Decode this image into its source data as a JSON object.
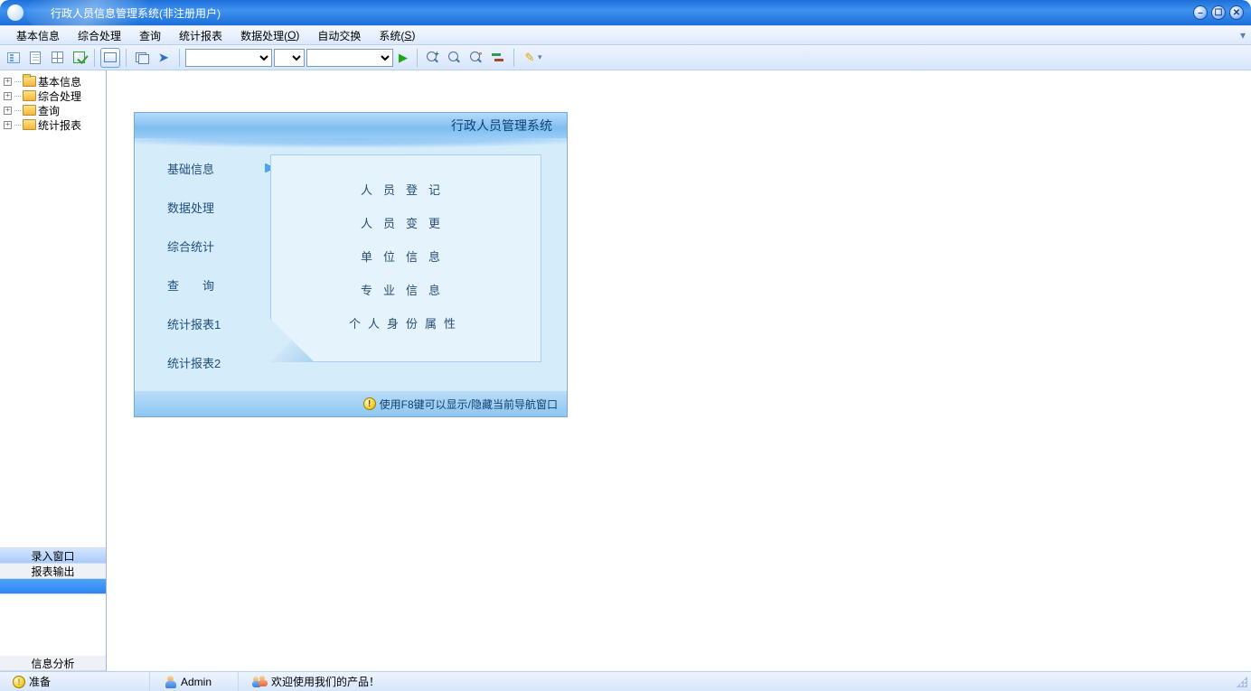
{
  "window": {
    "title": "行政人员信息管理系统(非注册用户)"
  },
  "menu": {
    "items": [
      {
        "label": "基本信息"
      },
      {
        "label": "综合处理"
      },
      {
        "label": "查询"
      },
      {
        "label": "统计报表"
      },
      {
        "label_pre": "数据处理(",
        "hot": "O",
        "label_post": ")"
      },
      {
        "label": "自动交换"
      },
      {
        "label_pre": "系统(",
        "hot": "S",
        "label_post": ")"
      }
    ]
  },
  "toolbar": {
    "combo1": "",
    "combo2": "",
    "combo3": ""
  },
  "tree": {
    "items": [
      {
        "label": "基本信息"
      },
      {
        "label": "综合处理"
      },
      {
        "label": "查询"
      },
      {
        "label": "统计报表"
      }
    ]
  },
  "sidebar_tabs": {
    "t1": "录入窗口",
    "t2": "报表输出",
    "t3": "信息分析"
  },
  "nav": {
    "header": "行政人员管理系统",
    "menu": [
      {
        "label": "基础信息"
      },
      {
        "label": "数据处理"
      },
      {
        "label": "综合统计"
      },
      {
        "label": "查　　询"
      },
      {
        "label": "统计报表1"
      },
      {
        "label": "统计报表2"
      }
    ],
    "options": [
      "人员登记",
      "人员变更",
      "单位信息",
      "专业信息",
      "个人身份属性"
    ],
    "footer": "使用F8键可以显示/隐藏当前导航窗口"
  },
  "status": {
    "ready": "准备",
    "user": "Admin",
    "welcome": "欢迎使用我们的产品！"
  }
}
